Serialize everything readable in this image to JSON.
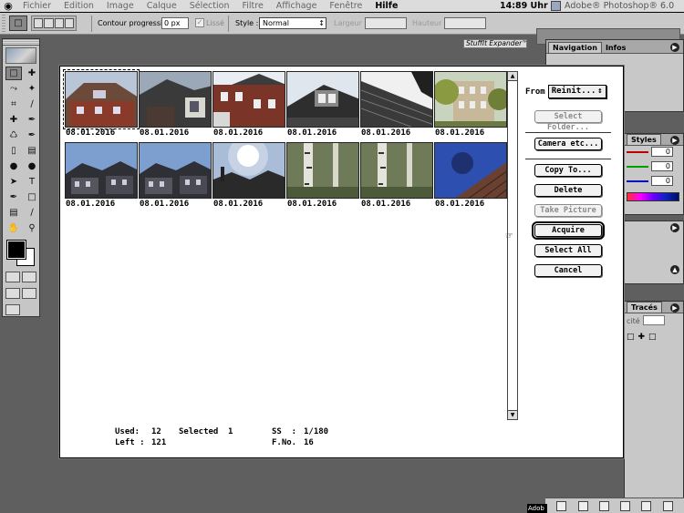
{
  "menubar": {
    "apple": "",
    "items": [
      "Fichier",
      "Edition",
      "Image",
      "Calque",
      "Sélection",
      "Filtre",
      "Affichage",
      "Fenêtre",
      "Hilfe"
    ],
    "clock": "14:89 Uhr",
    "app_name": "Adobe® Photoshop® 6.0"
  },
  "options_bar": {
    "feather_label": "Contour progressif :",
    "feather_value": "0 px",
    "antialias_label": "Lissé",
    "style_label": "Style :",
    "style_value": "Normal",
    "width_label": "Largeur :",
    "height_label": "Hauteur :"
  },
  "stuffit_tab": "StuffIt Expander™",
  "palettes": {
    "navigator_tabs": [
      "Navigation",
      "Infos"
    ],
    "styles_tab": "Styles",
    "color_values": [
      "0",
      "0",
      "0"
    ],
    "traces_tab": "Tracés",
    "traces_field_label": "cité"
  },
  "adobe_tab": "Adob",
  "dialog": {
    "thumbnails": [
      {
        "date": "08.01.2016",
        "scene": "house-roof",
        "selected": true
      },
      {
        "date": "08.01.2016",
        "scene": "dark-houses"
      },
      {
        "date": "08.01.2016",
        "scene": "brick-house"
      },
      {
        "date": "08.01.2016",
        "scene": "dormer"
      },
      {
        "date": "08.01.2016",
        "scene": "roof-tiles"
      },
      {
        "date": "08.01.2016",
        "scene": "tree-building"
      },
      {
        "date": "08.01.2016",
        "scene": "houses-sky"
      },
      {
        "date": "08.01.2016",
        "scene": "houses-sky"
      },
      {
        "date": "08.01.2016",
        "scene": "sun-glare"
      },
      {
        "date": "08.01.2016",
        "scene": "birch"
      },
      {
        "date": "08.01.2016",
        "scene": "birch"
      },
      {
        "date": "08.01.2016",
        "scene": "roof-blue"
      }
    ],
    "status": {
      "used_label": "Used:",
      "used_value": "12",
      "selected_label": "Selected",
      "selected_value": "1",
      "left_label": "Left :",
      "left_value": "121",
      "ss_label": "SS  :",
      "ss_value": "1/180",
      "fno_label": "F.No.",
      "fno_value": "16"
    },
    "from_label": "From",
    "from_value": "Reinit...",
    "buttons": {
      "select_folder": "Select Folder...",
      "camera_etc": "Camera etc...",
      "copy_to": "Copy To...",
      "delete": "Delete",
      "take_picture": "Take Picture",
      "acquire": "Acquire",
      "select_all": "Select All",
      "cancel": "Cancel"
    }
  }
}
